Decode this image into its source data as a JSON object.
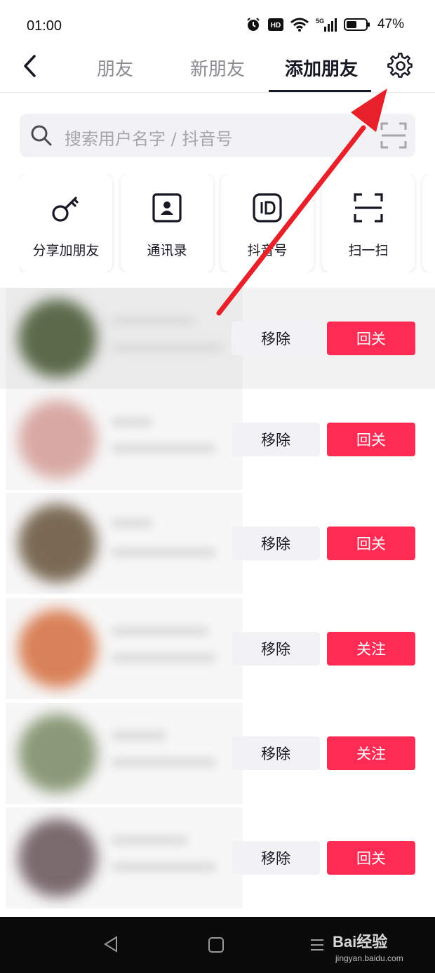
{
  "status": {
    "time": "01:00",
    "hd_label": "HD",
    "net_label": "5G",
    "battery": "47%"
  },
  "nav": {
    "tabs": [
      {
        "label": "朋友",
        "active": false
      },
      {
        "label": "新朋友",
        "active": false
      },
      {
        "label": "添加朋友",
        "active": true
      }
    ],
    "back_icon": "chevron-left-icon",
    "settings_icon": "gear-icon"
  },
  "search": {
    "placeholder": "搜索用户名字 / 抖音号"
  },
  "actions": [
    {
      "label": "分享加朋友",
      "icon": "key-icon"
    },
    {
      "label": "通讯录",
      "icon": "contact-card-icon"
    },
    {
      "label": "抖音号",
      "icon": "id-icon"
    },
    {
      "label": "扫一扫",
      "icon": "scan-icon"
    }
  ],
  "list": {
    "rows": [
      {
        "remove": "移除",
        "action": "回关"
      },
      {
        "remove": "移除",
        "action": "回关"
      },
      {
        "remove": "移除",
        "action": "回关"
      },
      {
        "remove": "移除",
        "action": "关注"
      },
      {
        "remove": "移除",
        "action": "关注"
      },
      {
        "remove": "移除",
        "action": "回关"
      }
    ]
  },
  "colors": {
    "accent": "#fe2c55",
    "annotation_arrow": "#e8202a"
  },
  "watermark": {
    "brand": "Bai经验",
    "url": "jingyan.baidu.com"
  }
}
